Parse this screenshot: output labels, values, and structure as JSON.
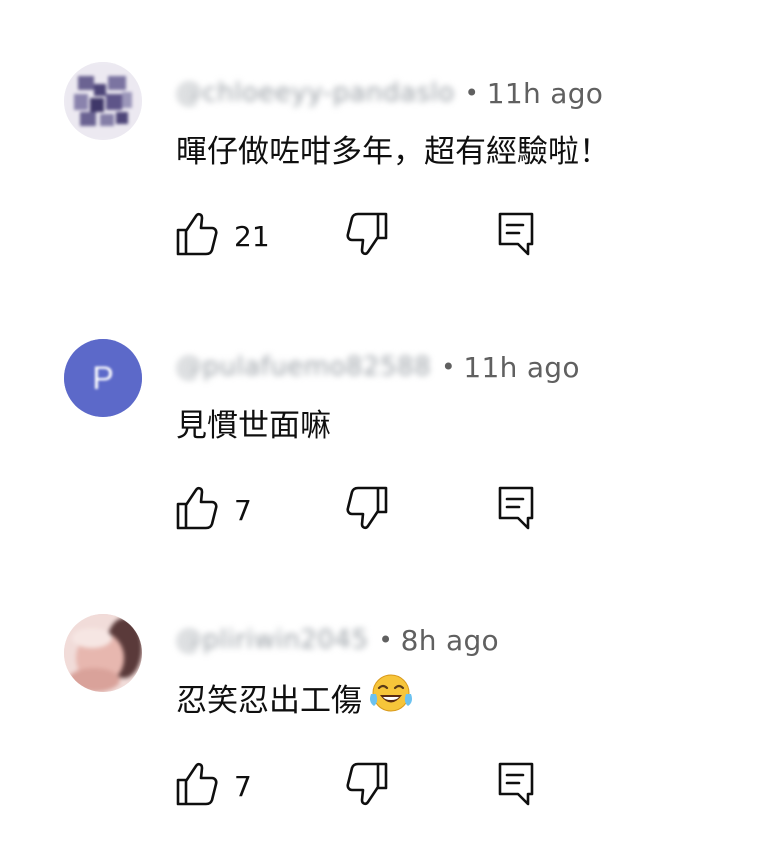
{
  "comments": [
    {
      "handle": "@chloeeyy-pandaslo",
      "separator": "•",
      "time": "11h ago",
      "text": "暉仔做咗咁多年，超有經驗啦！",
      "likes": "21",
      "avatar": {
        "type": "pattern",
        "color": "#5a4f86"
      }
    },
    {
      "handle": "@pulafuemo82588",
      "separator": "•",
      "time": "11h ago",
      "text": "見慣世面嘛",
      "likes": "7",
      "avatar": {
        "type": "letter",
        "letter": "P",
        "color": "#5c69c9"
      }
    },
    {
      "handle": "@pliriwin2045",
      "separator": "•",
      "time": "8h ago",
      "text": "忍笑忍出工傷",
      "emoji": "face-with-tears-of-joy",
      "likes": "7",
      "avatar": {
        "type": "photo",
        "color": "#e8c7c4"
      }
    }
  ],
  "icons": {
    "like": "thumbs-up-icon",
    "dislike": "thumbs-down-icon",
    "reply": "reply-comment-icon"
  }
}
